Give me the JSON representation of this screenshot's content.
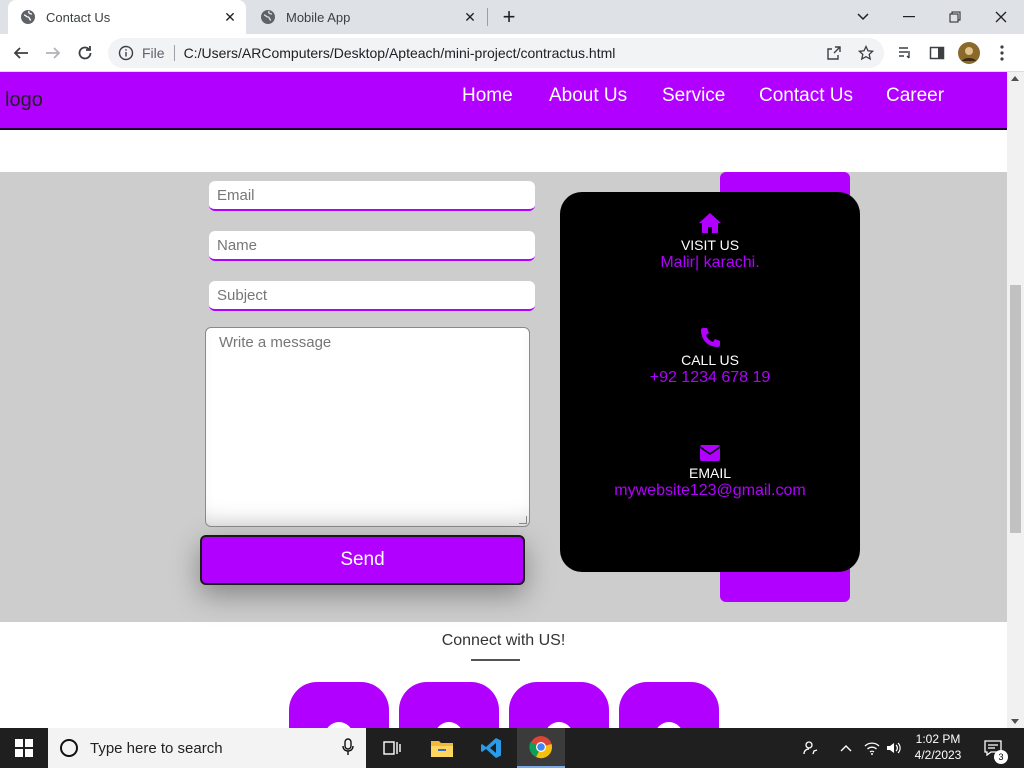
{
  "browser": {
    "tabs": [
      {
        "title": "Contact Us",
        "active": true
      },
      {
        "title": "Mobile App",
        "active": false
      }
    ],
    "address": {
      "scheme": "File",
      "url": "C:/Users/ARComputers/Desktop/Apteach/mini-project/contractus.html"
    }
  },
  "site": {
    "logo": "logo",
    "nav": [
      "Home",
      "About Us",
      "Service",
      "Contact Us",
      "Career"
    ],
    "form": {
      "email_placeholder": "Email",
      "name_placeholder": "Name",
      "subject_placeholder": "Subject",
      "message_placeholder": "Write a message",
      "send_label": "Send"
    },
    "info": [
      {
        "icon": "home-icon",
        "label": "VISIT US",
        "value": "Malir| karachi."
      },
      {
        "icon": "phone-icon",
        "label": "CALL US",
        "value": "+92 1234 678 19"
      },
      {
        "icon": "envelope-icon",
        "label": "EMAIL",
        "value": "mywebsite123@gmail.com"
      }
    ],
    "connect_heading": "Connect with US!"
  },
  "colors": {
    "accent": "#b100ff",
    "section_bg": "#cdcdcd",
    "card_bg": "#000000"
  },
  "taskbar": {
    "search_placeholder": "Type here to search",
    "time": "1:02 PM",
    "date": "4/2/2023",
    "notification_count": "3"
  }
}
